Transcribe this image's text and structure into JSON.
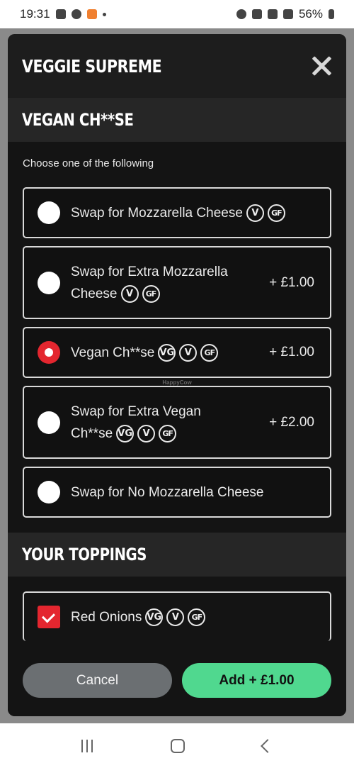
{
  "status_bar": {
    "time": "19:31",
    "battery": "56%"
  },
  "modal": {
    "title": "VEGGIE SUPREME",
    "sections": {
      "cheese": {
        "title": "VEGAN CH**SE",
        "subtitle": "Choose one of the following",
        "options": [
          {
            "label": "Swap for Mozzarella Cheese",
            "badges": [
              "V",
              "GF"
            ],
            "price": "",
            "selected": false
          },
          {
            "label": "Swap for Extra Mozzarella Cheese",
            "badges": [
              "V",
              "GF"
            ],
            "price": "+ £1.00",
            "selected": false
          },
          {
            "label": "Vegan Ch**se",
            "badges": [
              "VG",
              "V",
              "GF"
            ],
            "price": "+ £1.00",
            "selected": true
          },
          {
            "label": "Swap for Extra Vegan Ch**se",
            "badges": [
              "VG",
              "V",
              "GF"
            ],
            "price": "+ £2.00",
            "selected": false
          },
          {
            "label": "Swap for No Mozzarella Cheese",
            "badges": [],
            "price": "",
            "selected": false
          }
        ]
      },
      "toppings": {
        "title": "YOUR TOPPINGS",
        "items": [
          {
            "label": "Red Onions",
            "badges": [
              "VG",
              "V",
              "GF"
            ],
            "checked": true
          }
        ]
      }
    },
    "footer": {
      "cancel_label": "Cancel",
      "add_label": "Add + £1.00"
    }
  },
  "watermark": "HappyCow",
  "colors": {
    "accent_red": "#e4262f",
    "add_green": "#50d88f",
    "cancel_grey": "#6b6f72"
  }
}
